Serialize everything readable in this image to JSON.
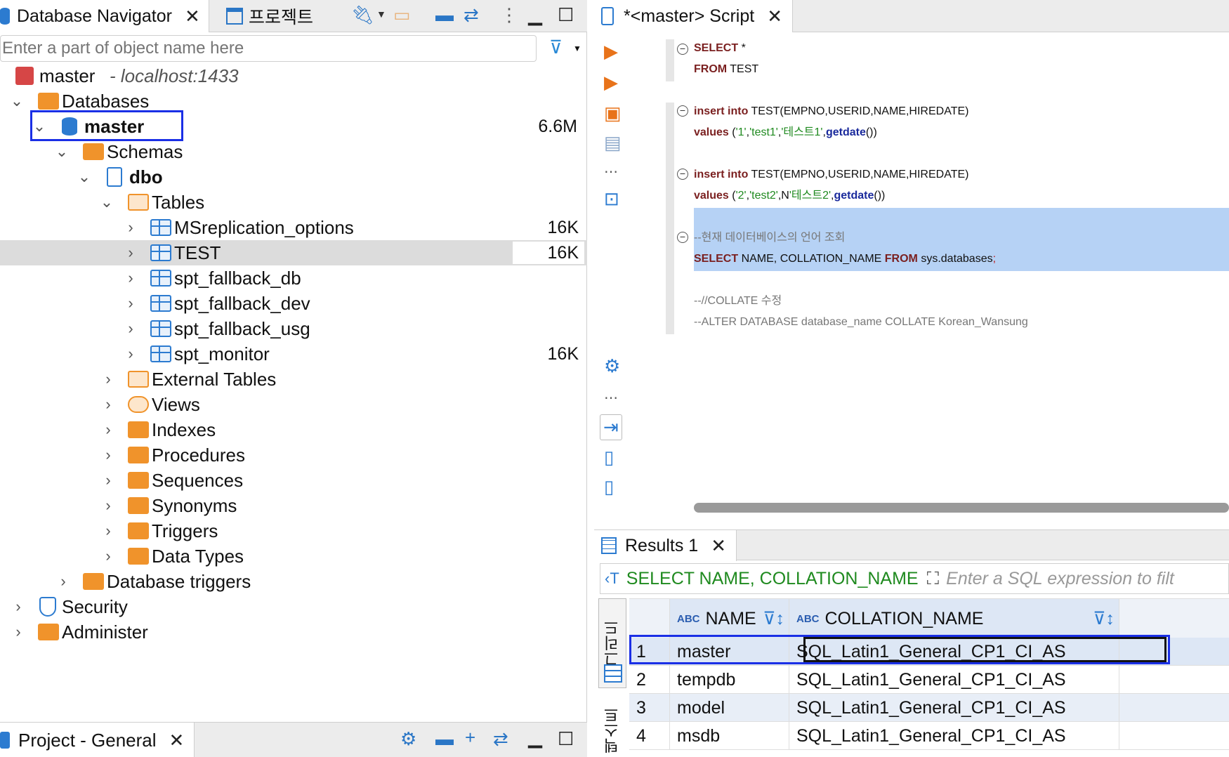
{
  "navigator": {
    "tab_title": "Database Navigator",
    "tab2_title": "프로젝트",
    "search_placeholder": "Enter a part of object name here",
    "connection": {
      "name": "master",
      "host": "- localhost:1433"
    },
    "tree": [
      {
        "label": "Databases",
        "size": ""
      },
      {
        "label": "master",
        "size": "6.6M"
      },
      {
        "label": "Schemas",
        "size": ""
      },
      {
        "label": "dbo",
        "size": ""
      },
      {
        "label": "Tables",
        "size": ""
      },
      {
        "label": "MSreplication_options",
        "size": "16K"
      },
      {
        "label": "TEST",
        "size": "16K"
      },
      {
        "label": "spt_fallback_db",
        "size": ""
      },
      {
        "label": "spt_fallback_dev",
        "size": ""
      },
      {
        "label": "spt_fallback_usg",
        "size": ""
      },
      {
        "label": "spt_monitor",
        "size": "16K"
      },
      {
        "label": "External Tables",
        "size": ""
      },
      {
        "label": "Views",
        "size": ""
      },
      {
        "label": "Indexes",
        "size": ""
      },
      {
        "label": "Procedures",
        "size": ""
      },
      {
        "label": "Sequences",
        "size": ""
      },
      {
        "label": "Synonyms",
        "size": ""
      },
      {
        "label": "Triggers",
        "size": ""
      },
      {
        "label": "Data Types",
        "size": ""
      },
      {
        "label": "Database triggers",
        "size": ""
      },
      {
        "label": "Security",
        "size": ""
      },
      {
        "label": "Administer",
        "size": ""
      }
    ],
    "bottom_tab": "Project - General"
  },
  "editor": {
    "tab_title": "*<master> Script",
    "lines": {
      "l1a": "SELECT",
      "l1b": " *",
      "l2a": "FROM",
      "l2b": " TEST",
      "l3a": "insert",
      "l3b": " ",
      "l3c": "into",
      "l3d": " TEST(EMPNO,USERID,NAME,HIREDATE)",
      "l4a": "values",
      "l4b": " (",
      "l4c": "'1'",
      "l4d": ",",
      "l4e": "'test1'",
      "l4f": ",",
      "l4g": "'테스트1'",
      "l4h": ",",
      "l4i": "getdate",
      "l4j": "())",
      "l5a": "insert",
      "l5b": " ",
      "l5c": "into",
      "l5d": " TEST(EMPNO,USERID,NAME,HIREDATE)",
      "l6a": "values",
      "l6b": " (",
      "l6c": "'2'",
      "l6d": ",",
      "l6e": "'test2'",
      "l6f": ",N",
      "l6g": "'테스트2'",
      "l6h": ",",
      "l6i": "getdate",
      "l6j": "())",
      "l7": "--현재 데이터베이스의 언어 조회",
      "l8a": "SELECT",
      "l8b": " NAME, COLLATION_NAME ",
      "l8c": "FROM",
      "l8d": " sys.databases",
      "l8e": ";",
      "l9": "--//COLLATE 수정",
      "l10": "--ALTER DATABASE database_name COLLATE Korean_Wansung"
    }
  },
  "results": {
    "tab_title": "Results 1",
    "query_text": "SELECT NAME, COLLATION_NAME",
    "filter_placeholder": "Enter a SQL expression to filt",
    "abc": "ABC",
    "columns": [
      "NAME",
      "COLLATION_NAME"
    ],
    "rows": [
      {
        "n": "1",
        "name": "master",
        "coll": "SQL_Latin1_General_CP1_CI_AS"
      },
      {
        "n": "2",
        "name": "tempdb",
        "coll": "SQL_Latin1_General_CP1_CI_AS"
      },
      {
        "n": "3",
        "name": "model",
        "coll": "SQL_Latin1_General_CP1_CI_AS"
      },
      {
        "n": "4",
        "name": "msdb",
        "coll": "SQL_Latin1_General_CP1_CI_AS"
      }
    ],
    "side_tab_grid": "그리드",
    "side_tab_text": "텍스트"
  }
}
